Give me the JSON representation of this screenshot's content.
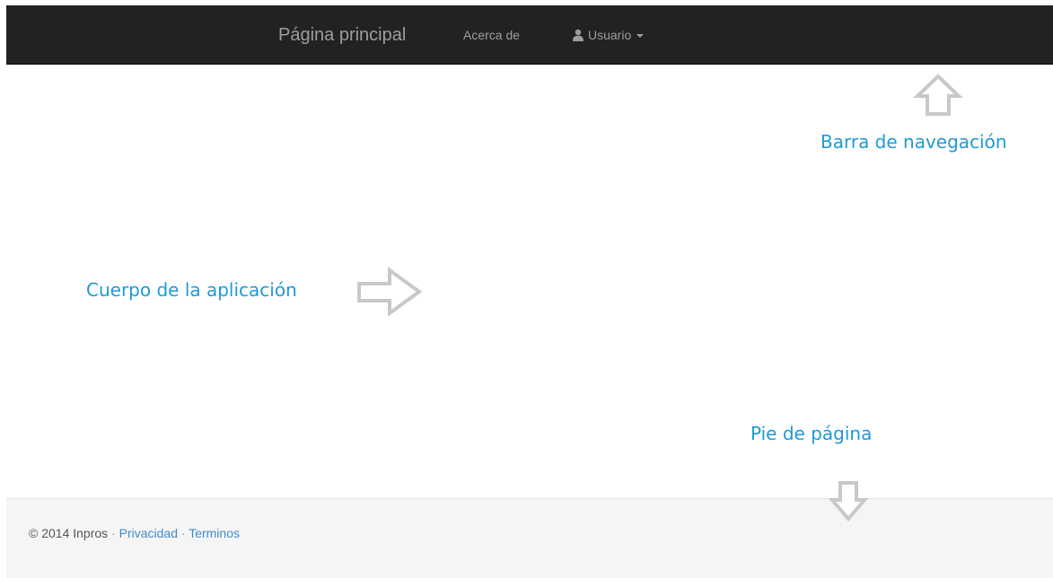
{
  "navbar": {
    "brand": "Página principal",
    "about": "Acerca de",
    "user": "Usuario",
    "user_icon": "user-icon",
    "dropdown_icon": "caret-down-icon"
  },
  "annotations": {
    "navbar": "Barra de navegación",
    "body": "Cuerpo de la aplicación",
    "footer": "Pie de página"
  },
  "footer": {
    "copyright": "© 2014 Inpros",
    "separator": "·",
    "privacy": "Privacidad",
    "terms": "Terminos"
  },
  "colors": {
    "navbar_bg": "#222222",
    "navbar_text": "#9d9d9d",
    "annotation": "#1e9ad6",
    "arrow": "#c8c8c8",
    "footer_bg": "#f5f5f5",
    "link": "#428bca"
  }
}
